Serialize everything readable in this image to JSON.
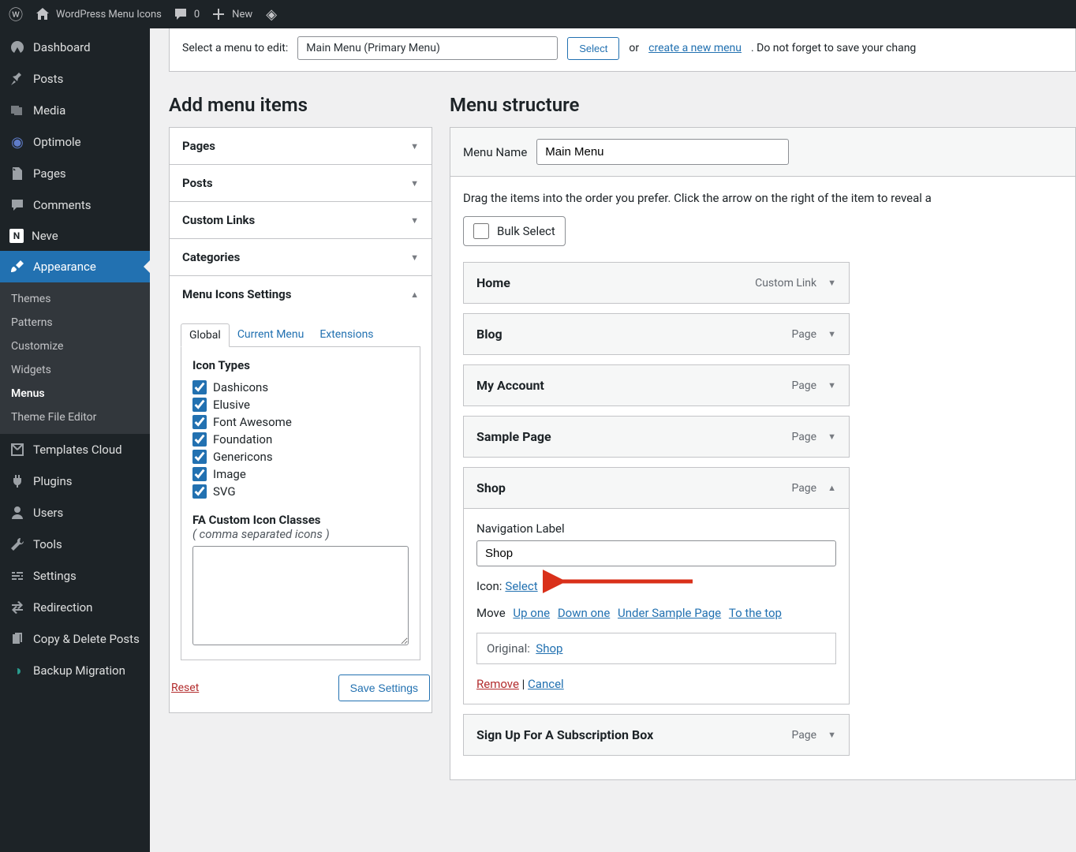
{
  "topbar": {
    "site_name": "WordPress Menu Icons",
    "comments_count": "0",
    "new_label": "New"
  },
  "sidebar": {
    "items": [
      {
        "label": "Dashboard"
      },
      {
        "label": "Posts"
      },
      {
        "label": "Media"
      },
      {
        "label": "Optimole"
      },
      {
        "label": "Pages"
      },
      {
        "label": "Comments"
      },
      {
        "label": "Neve"
      },
      {
        "label": "Appearance"
      },
      {
        "label": "Templates Cloud"
      },
      {
        "label": "Plugins"
      },
      {
        "label": "Users"
      },
      {
        "label": "Tools"
      },
      {
        "label": "Settings"
      },
      {
        "label": "Redirection"
      },
      {
        "label": "Copy & Delete Posts"
      },
      {
        "label": "Backup Migration"
      }
    ],
    "appearance_sub": [
      {
        "label": "Themes"
      },
      {
        "label": "Patterns"
      },
      {
        "label": "Customize"
      },
      {
        "label": "Widgets"
      },
      {
        "label": "Menus"
      },
      {
        "label": "Theme File Editor"
      }
    ]
  },
  "topbox": {
    "prefix": "Select a menu to edit:",
    "selected_menu": "Main Menu (Primary Menu)",
    "select_btn": "Select",
    "or": "or",
    "create_link": "create a new menu",
    "suffix": ". Do not forget to save your chang"
  },
  "add_menu": {
    "heading": "Add menu items",
    "accordions": [
      "Pages",
      "Posts",
      "Custom Links",
      "Categories",
      "Menu Icons Settings"
    ],
    "tabs": [
      "Global",
      "Current Menu",
      "Extensions"
    ],
    "icon_types_heading": "Icon Types",
    "icon_types": [
      "Dashicons",
      "Elusive",
      "Font Awesome",
      "Foundation",
      "Genericons",
      "Image",
      "SVG"
    ],
    "fa_heading": "FA Custom Icon Classes",
    "fa_note": "( comma separated icons )",
    "reset": "Reset",
    "save": "Save Settings"
  },
  "menu_struct": {
    "heading": "Menu structure",
    "name_label": "Menu Name",
    "name_value": "Main Menu",
    "drag_note": "Drag the items into the order you prefer. Click the arrow on the right of the item to reveal a",
    "bulk_label": "Bulk Select",
    "items": [
      {
        "title": "Home",
        "type": "Custom Link"
      },
      {
        "title": "Blog",
        "type": "Page"
      },
      {
        "title": "My Account",
        "type": "Page"
      },
      {
        "title": "Sample Page",
        "type": "Page"
      },
      {
        "title": "Shop",
        "type": "Page"
      },
      {
        "title": "Sign Up For A Subscription Box",
        "type": "Page"
      }
    ],
    "expanded": {
      "nav_label": "Navigation Label",
      "nav_value": "Shop",
      "icon_label": "Icon:",
      "icon_select": "Select",
      "move_label": "Move",
      "move_links": [
        "Up one",
        "Down one",
        "Under Sample Page",
        "To the top"
      ],
      "original_label": "Original:",
      "original_link": "Shop",
      "remove": "Remove",
      "cancel": "Cancel"
    }
  }
}
